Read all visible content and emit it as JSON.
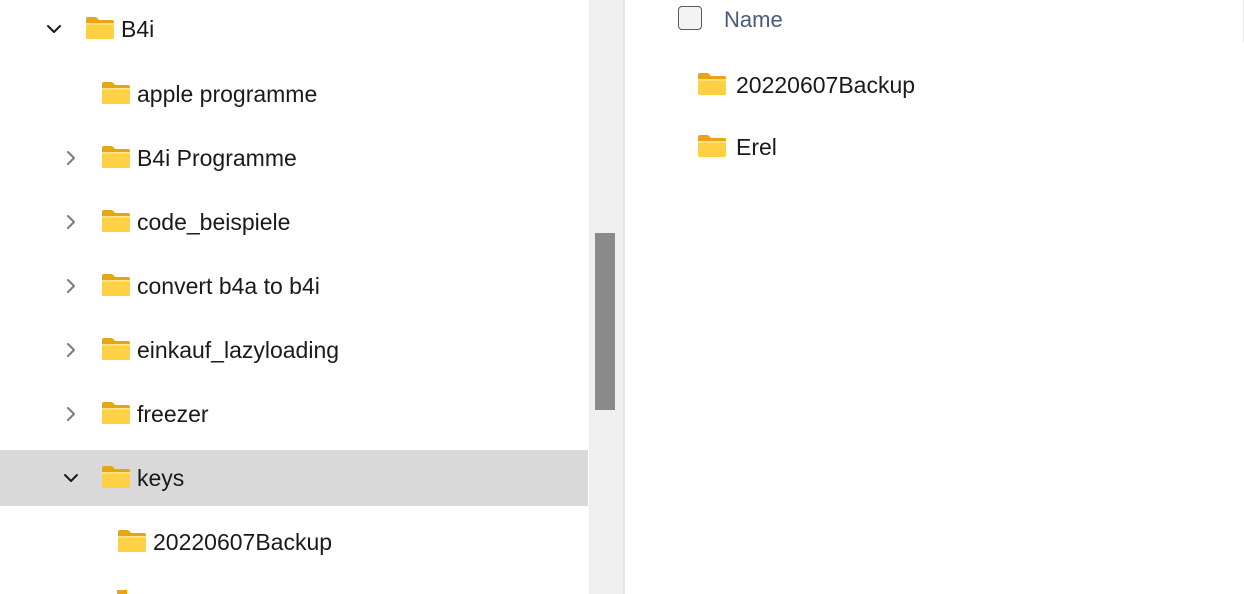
{
  "navigation_tree": {
    "items": [
      {
        "label": "B4i",
        "state": "expanded"
      },
      {
        "label": "apple programme",
        "state": "none"
      },
      {
        "label": "B4i Programme",
        "state": "collapsed"
      },
      {
        "label": "code_beispiele",
        "state": "collapsed"
      },
      {
        "label": "convert b4a to b4i",
        "state": "collapsed"
      },
      {
        "label": "einkauf_lazyloading",
        "state": "collapsed"
      },
      {
        "label": "freezer",
        "state": "collapsed"
      },
      {
        "label": "keys",
        "state": "expanded",
        "selected": true
      },
      {
        "label": "20220607Backup",
        "state": "none"
      }
    ]
  },
  "content": {
    "column_header": {
      "name_label": "Name"
    },
    "items": [
      {
        "label": "20220607Backup"
      },
      {
        "label": "Erel"
      }
    ]
  },
  "icons": {
    "folder": "folder-icon",
    "expand": "chevron-down-icon",
    "collapse": "chevron-right-icon"
  },
  "colors": {
    "selected_row": "#d9d9d9",
    "folder_body": "#ffd043",
    "folder_tab": "#e8a317",
    "scroll_thumb": "#8a8a8a",
    "header_text": "#4a5a7a"
  }
}
